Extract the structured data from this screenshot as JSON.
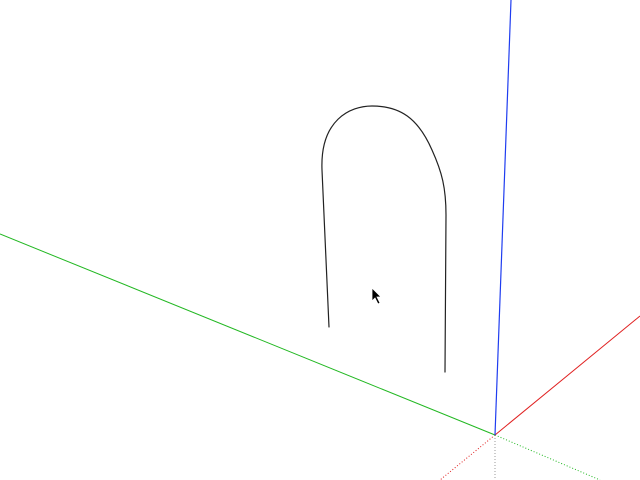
{
  "viewport": {
    "background": "#ffffff",
    "axes": {
      "red_axis_color": "#e02020",
      "green_axis_color": "#22b822",
      "blue_axis_color": "#1f3df0",
      "hidden_axis_color": "#9a9a9a"
    },
    "sketch": {
      "shape": "arch",
      "stroke_color": "#222222"
    },
    "cursor": {
      "icon": "arrow-cursor-icon",
      "color": "#000000"
    }
  }
}
